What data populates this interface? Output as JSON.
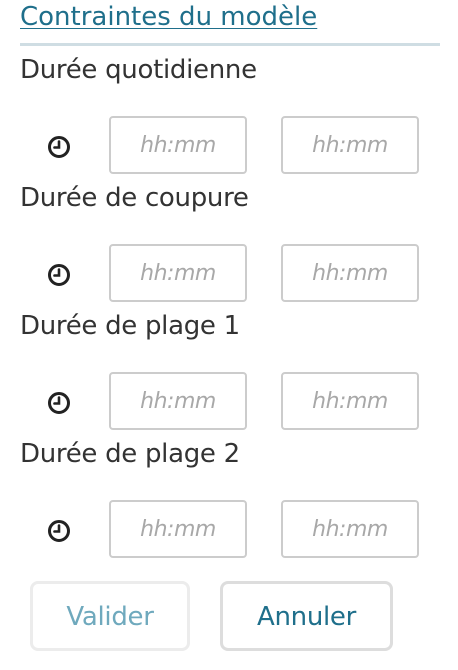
{
  "panel": {
    "title": "Contraintes du modèle"
  },
  "sections": [
    {
      "label": "Durée quotidienne",
      "icon": "clock-icon",
      "input_a": {
        "value": "",
        "placeholder": "hh:mm"
      },
      "input_b": {
        "value": "",
        "placeholder": "hh:mm"
      }
    },
    {
      "label": "Durée de coupure",
      "icon": "clock-icon",
      "input_a": {
        "value": "",
        "placeholder": "hh:mm"
      },
      "input_b": {
        "value": "",
        "placeholder": "hh:mm"
      }
    },
    {
      "label": "Durée de plage 1",
      "icon": "clock-icon",
      "input_a": {
        "value": "",
        "placeholder": "hh:mm"
      },
      "input_b": {
        "value": "",
        "placeholder": "hh:mm"
      }
    },
    {
      "label": "Durée de plage 2",
      "icon": "clock-icon",
      "input_a": {
        "value": "",
        "placeholder": "hh:mm"
      },
      "input_b": {
        "value": "",
        "placeholder": "hh:mm"
      }
    }
  ],
  "actions": {
    "validate_label": "Valider",
    "cancel_label": "Annuler"
  },
  "colors": {
    "title": "#1f6f8b",
    "title_rule": "#cfdde3",
    "text": "#333333",
    "placeholder": "#a8a8a8",
    "input_border": "#cccccc",
    "validate_text": "#6fa9bd",
    "cancel_text": "#1f6f8b"
  }
}
